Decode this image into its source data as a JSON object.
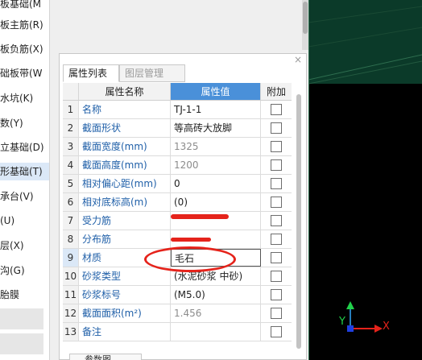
{
  "tree": {
    "items": [
      {
        "label": "板基础(M",
        "selected": false
      },
      {
        "label": "板主筋(R)",
        "selected": false
      },
      {
        "label": "板负筋(X)",
        "selected": false
      },
      {
        "label": "础板带(W",
        "selected": false
      },
      {
        "label": "水坑(K)",
        "selected": false
      },
      {
        "label": "数(Y)",
        "selected": false
      },
      {
        "label": "立基础(D)",
        "selected": false
      },
      {
        "label": "形基础(T)",
        "selected": true
      },
      {
        "label": "承台(V)",
        "selected": false
      },
      {
        "label": "(U)",
        "selected": false
      },
      {
        "label": "层(X)",
        "selected": false
      },
      {
        "label": "沟(G)",
        "selected": false
      },
      {
        "label": "胎膜",
        "selected": false
      }
    ]
  },
  "properties": {
    "tabs": [
      {
        "label": "属性列表",
        "active": true
      },
      {
        "label": "图层管理",
        "active": false
      }
    ],
    "columns": {
      "name": "属性名称",
      "value": "属性值",
      "extra": "附加"
    },
    "rows": [
      {
        "num": "1",
        "name": "名称",
        "value": "TJ-1-1",
        "value_gray": false
      },
      {
        "num": "2",
        "name": "截面形状",
        "value": "等高砖大放脚",
        "value_gray": false
      },
      {
        "num": "3",
        "name": "截面宽度(mm)",
        "value": "1325",
        "value_gray": true
      },
      {
        "num": "4",
        "name": "截面高度(mm)",
        "value": "1200",
        "value_gray": true
      },
      {
        "num": "5",
        "name": "相对偏心距(mm)",
        "value": "0",
        "value_gray": false
      },
      {
        "num": "6",
        "name": "相对底标高(m)",
        "value": "(0)",
        "value_gray": false
      },
      {
        "num": "7",
        "name": "受力筋",
        "value": "",
        "value_gray": false
      },
      {
        "num": "8",
        "name": "分布筋",
        "value": "",
        "value_gray": false
      },
      {
        "num": "9",
        "name": "材质",
        "value": "毛石",
        "value_gray": false,
        "highlighted": true
      },
      {
        "num": "10",
        "name": "砂浆类型",
        "value": "(水泥砂浆 中砂)",
        "value_gray": false
      },
      {
        "num": "11",
        "name": "砂浆标号",
        "value": "(M5.0)",
        "value_gray": false
      },
      {
        "num": "12",
        "name": "截面面积(m²)",
        "value": "1.456",
        "value_gray": true
      },
      {
        "num": "13",
        "name": "备注",
        "value": "",
        "value_gray": false
      }
    ],
    "close_glyph": "×",
    "bottom_button": "参数图"
  },
  "view3d": {
    "axis_y": "Y",
    "axis_x": "X",
    "colors": {
      "background": "#000000",
      "floor": "#0b3a29",
      "annotation": "#e5231b",
      "accent": "#4a90d9"
    }
  }
}
